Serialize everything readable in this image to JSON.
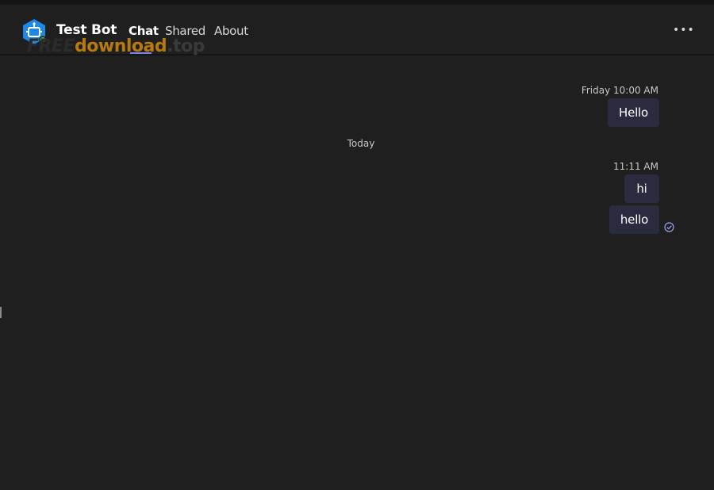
{
  "header": {
    "bot_name": "Test Bot",
    "bot_avatar_icon": "robot-icon",
    "tabs": [
      {
        "label": "Chat",
        "active": true
      },
      {
        "label": "Shared",
        "active": false
      },
      {
        "label": "About",
        "active": false
      }
    ],
    "more_icon": "more-options-icon",
    "more_glyph": "•••"
  },
  "watermark": {
    "part1": "FREE",
    "part2": "download",
    "part3": ".top"
  },
  "conversation": {
    "groups": [
      {
        "timestamp": "Friday 10:00 AM",
        "messages": [
          {
            "text": "Hello"
          }
        ]
      },
      {
        "divider": "Today",
        "timestamp": "11:11 AM",
        "messages": [
          {
            "text": "hi"
          },
          {
            "text": "hello",
            "status_icon": "read-receipt-icon"
          }
        ]
      }
    ]
  },
  "colors": {
    "background": "#1f1f1f",
    "bubble": "#2b2b40",
    "accent": "#7f85f5",
    "avatar": "#1e88e5"
  }
}
